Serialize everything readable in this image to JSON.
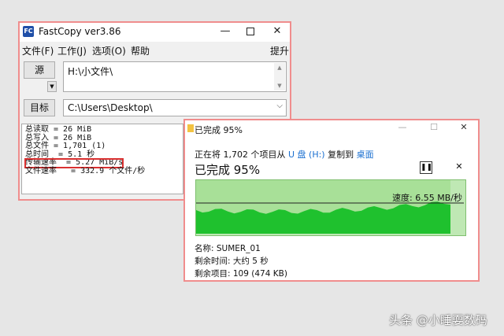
{
  "fastcopy": {
    "title": "FastCopy ver3.86",
    "logo_text": "FC",
    "menu": [
      "文件(F)",
      "工作(J)",
      "选项(O)",
      "帮助"
    ],
    "menu_right": "提升",
    "source_button": "源",
    "source_value": "H:\\小文件\\",
    "dest_button": "目标",
    "dest_value": "C:\\Users\\Desktop\\",
    "log_lines": [
      "总读取 = 26 MiB",
      "总写入 = 26 MiB",
      "总文件 = 1,701 (1)",
      "总时间  = 5.1 秒",
      "传输速率  = 5.27 MiB/s",
      "文件速率   = 332.9 个文件/秒"
    ],
    "highlight_color": "#d93030"
  },
  "copy_dialog": {
    "title": "已完成 95%",
    "line_prefix": "正在将 1,702 个项目从 ",
    "source": "U 盘 (H:)",
    "mid": " 复制到 ",
    "dest": "桌面",
    "status": "已完成 95%",
    "speed": "速度: 6.55 MB/秒",
    "name_line": "名称: SUMER_01",
    "time_line": "剩余时间: 大约 5 秒",
    "items_line": "剩余项目: 109 (474 KB)",
    "progress": 0.95,
    "chart_fill": "#1fc12e",
    "chart_bg": "#bfe8b4"
  },
  "watermark": "头条 @小睡耍数码"
}
